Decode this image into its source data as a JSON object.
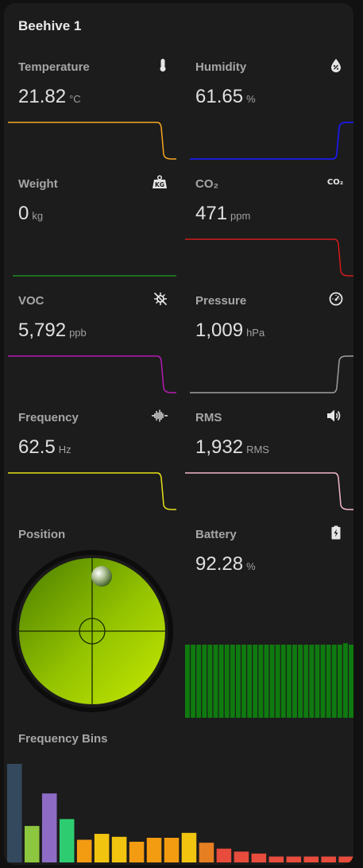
{
  "card": {
    "title": "Beehive 1"
  },
  "tiles": [
    {
      "name": "Temperature",
      "value": "21.82",
      "unit": "°C",
      "color": "#f5a623",
      "icon": "thermometer-icon"
    },
    {
      "name": "Humidity",
      "value": "61.65",
      "unit": "%",
      "color": "#1a1ad6",
      "icon": "water-percent-icon"
    },
    {
      "name": "Weight",
      "value": "0",
      "unit": "kg",
      "color": "#1f8a1f",
      "icon": "weight-kilogram-icon"
    },
    {
      "name": "CO₂",
      "value": "471",
      "unit": "ppm",
      "color": "#d11b1b",
      "icon": "molecule-co2-icon",
      "icon_text": "CO₂"
    },
    {
      "name": "VOC",
      "value": "5,792",
      "unit": "ppb",
      "color": "#b31bb3",
      "icon": "virus-off-icon"
    },
    {
      "name": "Pressure",
      "value": "1,009",
      "unit": "hPa",
      "color": "#9e9e9e",
      "icon": "gauge-icon"
    },
    {
      "name": "Frequency",
      "value": "62.5",
      "unit": "Hz",
      "color": "#e8e01a",
      "icon": "waveform-icon"
    },
    {
      "name": "RMS",
      "value": "1,932",
      "unit": "RMS",
      "color": "#f2b8c6",
      "icon": "volume-high-icon"
    }
  ],
  "position": {
    "name": "Position"
  },
  "battery": {
    "name": "Battery",
    "value": "92.28",
    "unit": "%",
    "level": 0.92,
    "color": "#0f7a0f",
    "icon": "battery-charging-icon"
  },
  "frequency_bins": {
    "title": "Frequency Bins",
    "values": [
      100,
      37,
      70,
      44,
      23,
      29,
      26,
      21,
      25,
      25,
      30,
      20,
      14,
      11,
      9,
      6,
      6,
      6,
      6,
      6
    ],
    "colors": [
      "#34495e",
      "#8dc63f",
      "#8e6cc5",
      "#2ecc71",
      "#f39c12",
      "#f1c40f",
      "#f1c40f",
      "#f39c12",
      "#f39c12",
      "#f39c12",
      "#f1c40f",
      "#e67e22",
      "#e74c3c",
      "#e74c3c",
      "#e74c3c",
      "#e74c3c",
      "#e74c3c",
      "#e74c3c",
      "#e74c3c",
      "#e74c3c"
    ]
  }
}
